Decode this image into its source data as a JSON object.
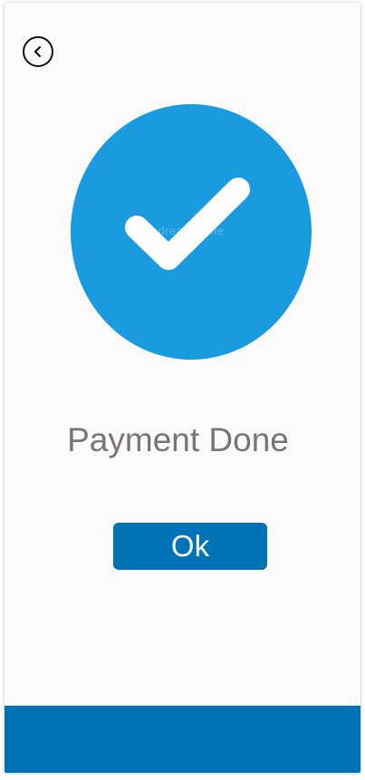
{
  "screen": {
    "title": "Payment Done",
    "watermark": "dreamstime",
    "ok_label": "Ok"
  },
  "icons": {
    "back": "chevron-left-icon",
    "success": "checkmark-icon"
  },
  "colors": {
    "accent": "#1a9be0",
    "button": "#0072b6",
    "bottom_bar": "#0072b6",
    "title_text": "#7a7473",
    "background": "#fbfbfb"
  }
}
